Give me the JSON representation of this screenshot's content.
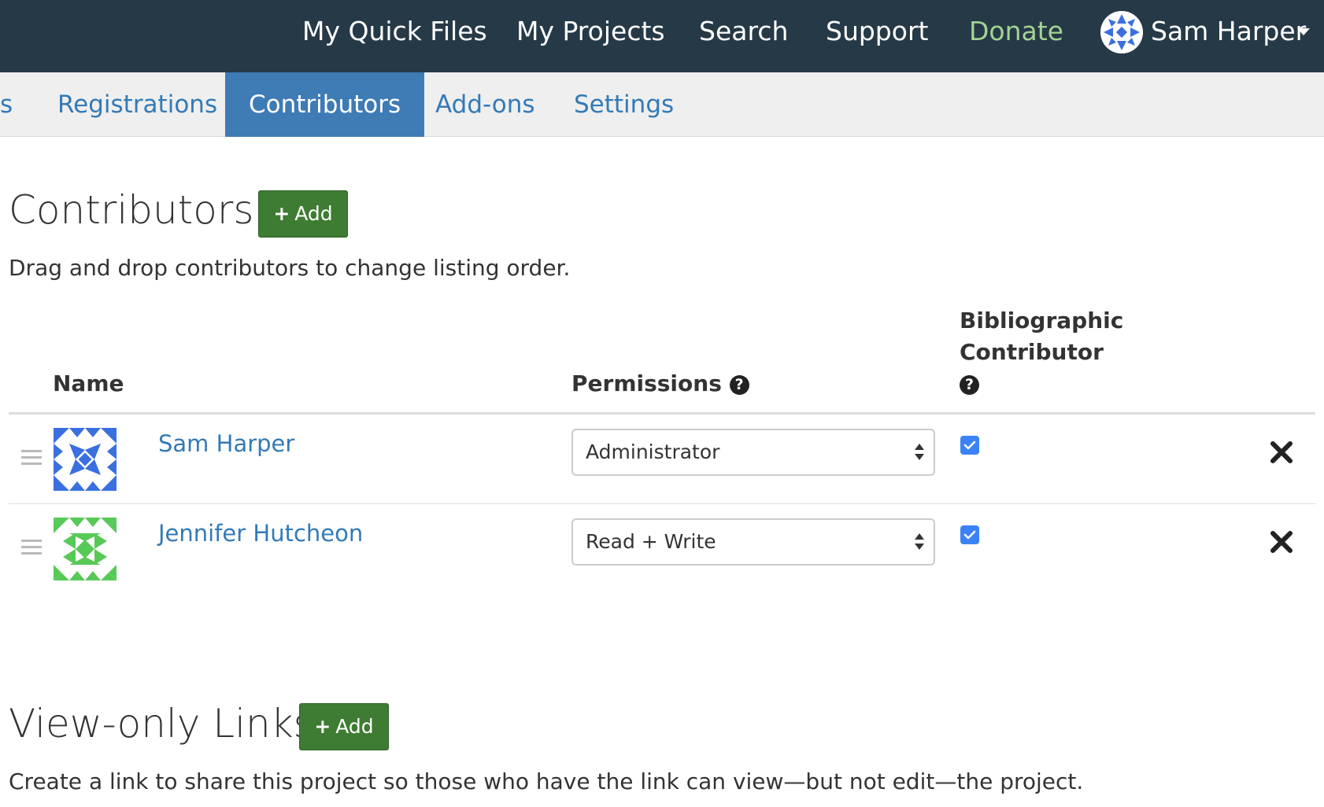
{
  "topnav": {
    "links": [
      "My Quick Files",
      "My Projects",
      "Search",
      "Support"
    ],
    "donate": "Donate",
    "user_name": "Sam Harper",
    "user_caret": "caret-down-icon"
  },
  "subnav": {
    "partial_tab": "s",
    "tabs": [
      "Registrations",
      "Contributors",
      "Add-ons",
      "Settings"
    ],
    "active_tab": "Contributors"
  },
  "contributors_section": {
    "title": "Contributors",
    "add_label": "Add",
    "description": "Drag and drop contributors to change listing order.",
    "columns": {
      "name": "Name",
      "permissions": "Permissions",
      "bibliographic_line1": "Bibliographic",
      "bibliographic_line2": "Contributor"
    },
    "rows": [
      {
        "name": "Sam Harper",
        "permission": "Administrator",
        "bibliographic": true,
        "avatar_color": "#3b6fe0"
      },
      {
        "name": "Jennifer Hutcheon",
        "permission": "Read + Write",
        "bibliographic": true,
        "avatar_color": "#57c957"
      }
    ]
  },
  "view_only_section": {
    "title": "View-only Links",
    "add_label": "Add",
    "description": "Create a link to share this project so those who have the link can view—but not edit—the project."
  },
  "colors": {
    "navbar": "#263947",
    "donate": "#a3d393",
    "active_tab": "#3f7bb5",
    "link": "#337ab7",
    "add_button": "#3e7c33",
    "checkbox": "#3b82f6"
  }
}
